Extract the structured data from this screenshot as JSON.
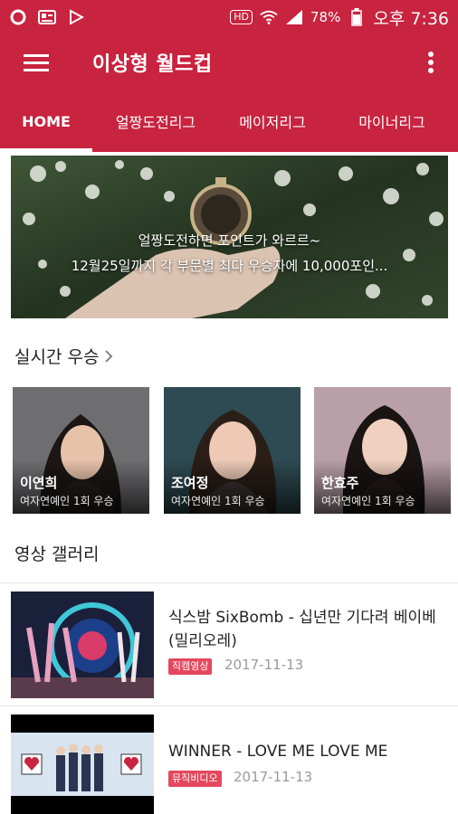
{
  "status_bar": {
    "left_icons": [
      "opera-icon",
      "card-icon",
      "play-store-icon"
    ],
    "hd_label": "HD",
    "battery": "78%",
    "time": "오후 7:36"
  },
  "app_bar": {
    "title": "이상형 월드컵"
  },
  "tabs": [
    {
      "label": "HOME",
      "active": true
    },
    {
      "label": "얼짱도전리그",
      "active": false
    },
    {
      "label": "메이저리그",
      "active": false
    },
    {
      "label": "마이너리그",
      "active": false
    }
  ],
  "banner": {
    "line1": "얼짱도전하면 포인트가 와르르~",
    "line2": "12월25일까지 각 부문별 최다 우승자에 10,000포인..."
  },
  "realtime_winners": {
    "title": "실시간 우승",
    "items": [
      {
        "name": "이연희",
        "subtitle": "여자연예인 1회 우승"
      },
      {
        "name": "조여정",
        "subtitle": "여자연예인 1회 우승"
      },
      {
        "name": "한효주",
        "subtitle": "여자연예인 1회 우승"
      }
    ]
  },
  "video_gallery": {
    "title": "영상 갤러리",
    "items": [
      {
        "title": "식스밤 SixBomb - 십년만 기다려 베이베(밀리오레)",
        "badge": "직캠영상",
        "date": "2017-11-13"
      },
      {
        "title": "WINNER - LOVE ME LOVE ME",
        "badge": "뮤직비디오",
        "date": "2017-11-13"
      }
    ]
  },
  "colors": {
    "brand_red": "#c8233f",
    "badge_red": "#e4475e"
  }
}
